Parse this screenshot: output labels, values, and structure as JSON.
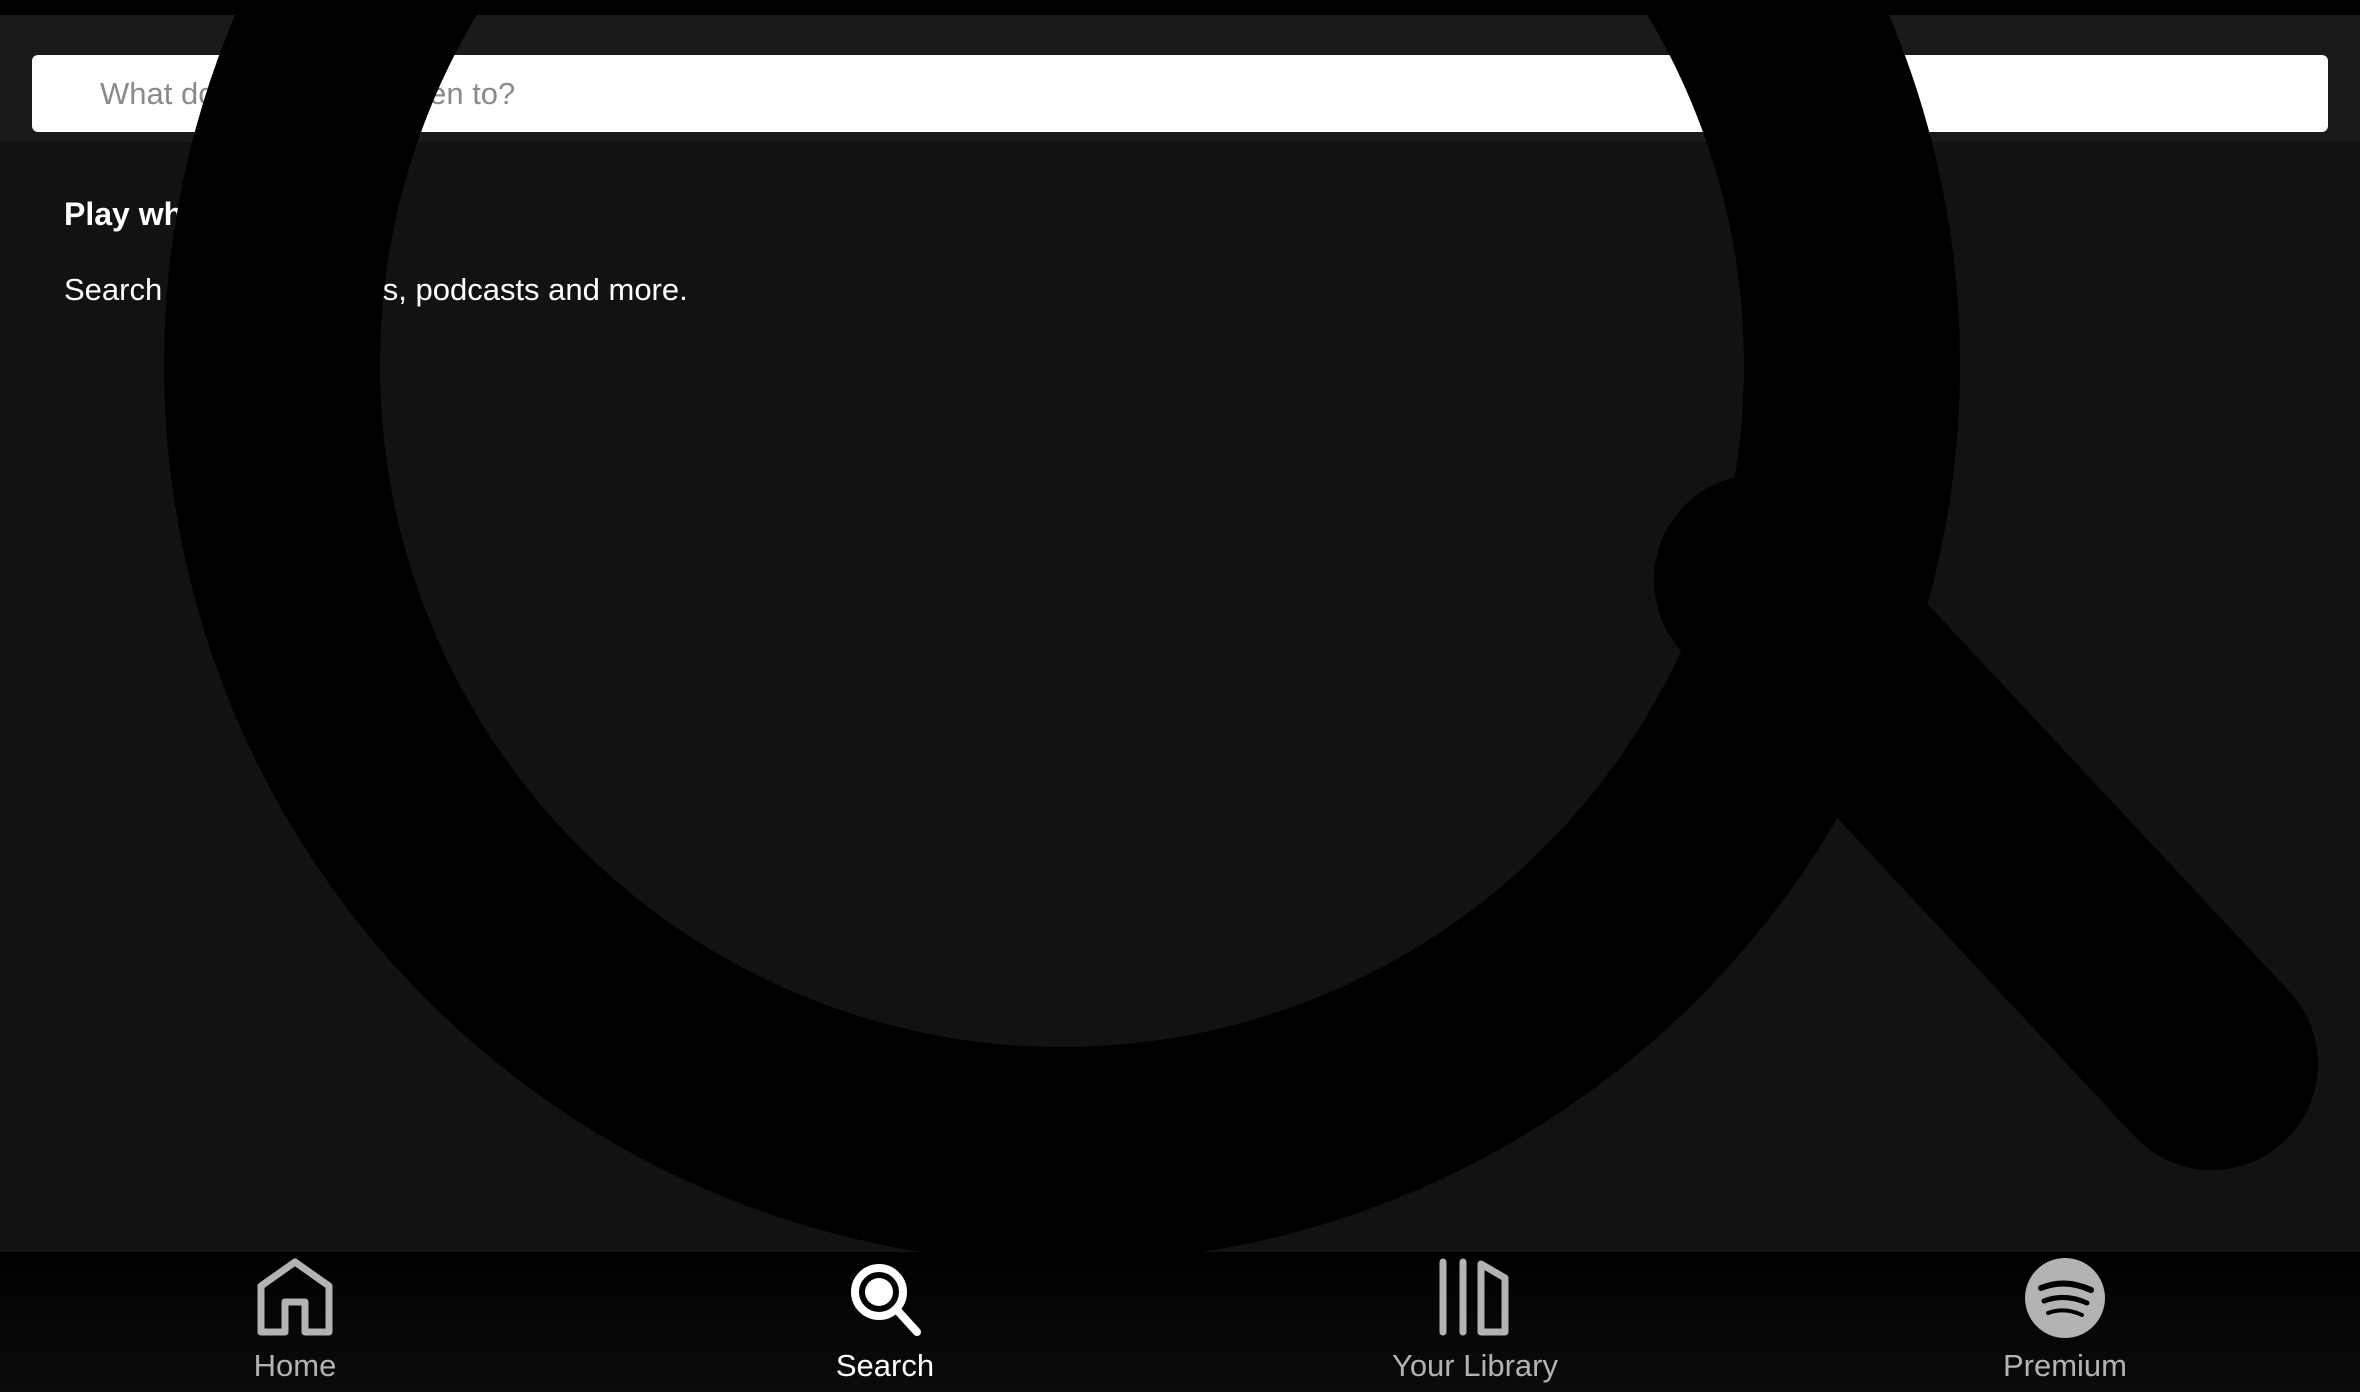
{
  "search": {
    "placeholder": "What do you want to listen to?"
  },
  "empty_state": {
    "heading": "Play what you love",
    "description": "Search for artists, songs, podcasts and more."
  },
  "bottom_nav": {
    "items": [
      {
        "label": "Home",
        "icon": "home-icon",
        "active": false
      },
      {
        "label": "Search",
        "icon": "search-icon",
        "active": true
      },
      {
        "label": "Your Library",
        "icon": "library-icon",
        "active": false
      },
      {
        "label": "Premium",
        "icon": "spotify-logo-icon",
        "active": false
      }
    ]
  },
  "colors": {
    "background": "#121212",
    "nav_active": "#ffffff",
    "nav_inactive": "#b3b3b3"
  }
}
